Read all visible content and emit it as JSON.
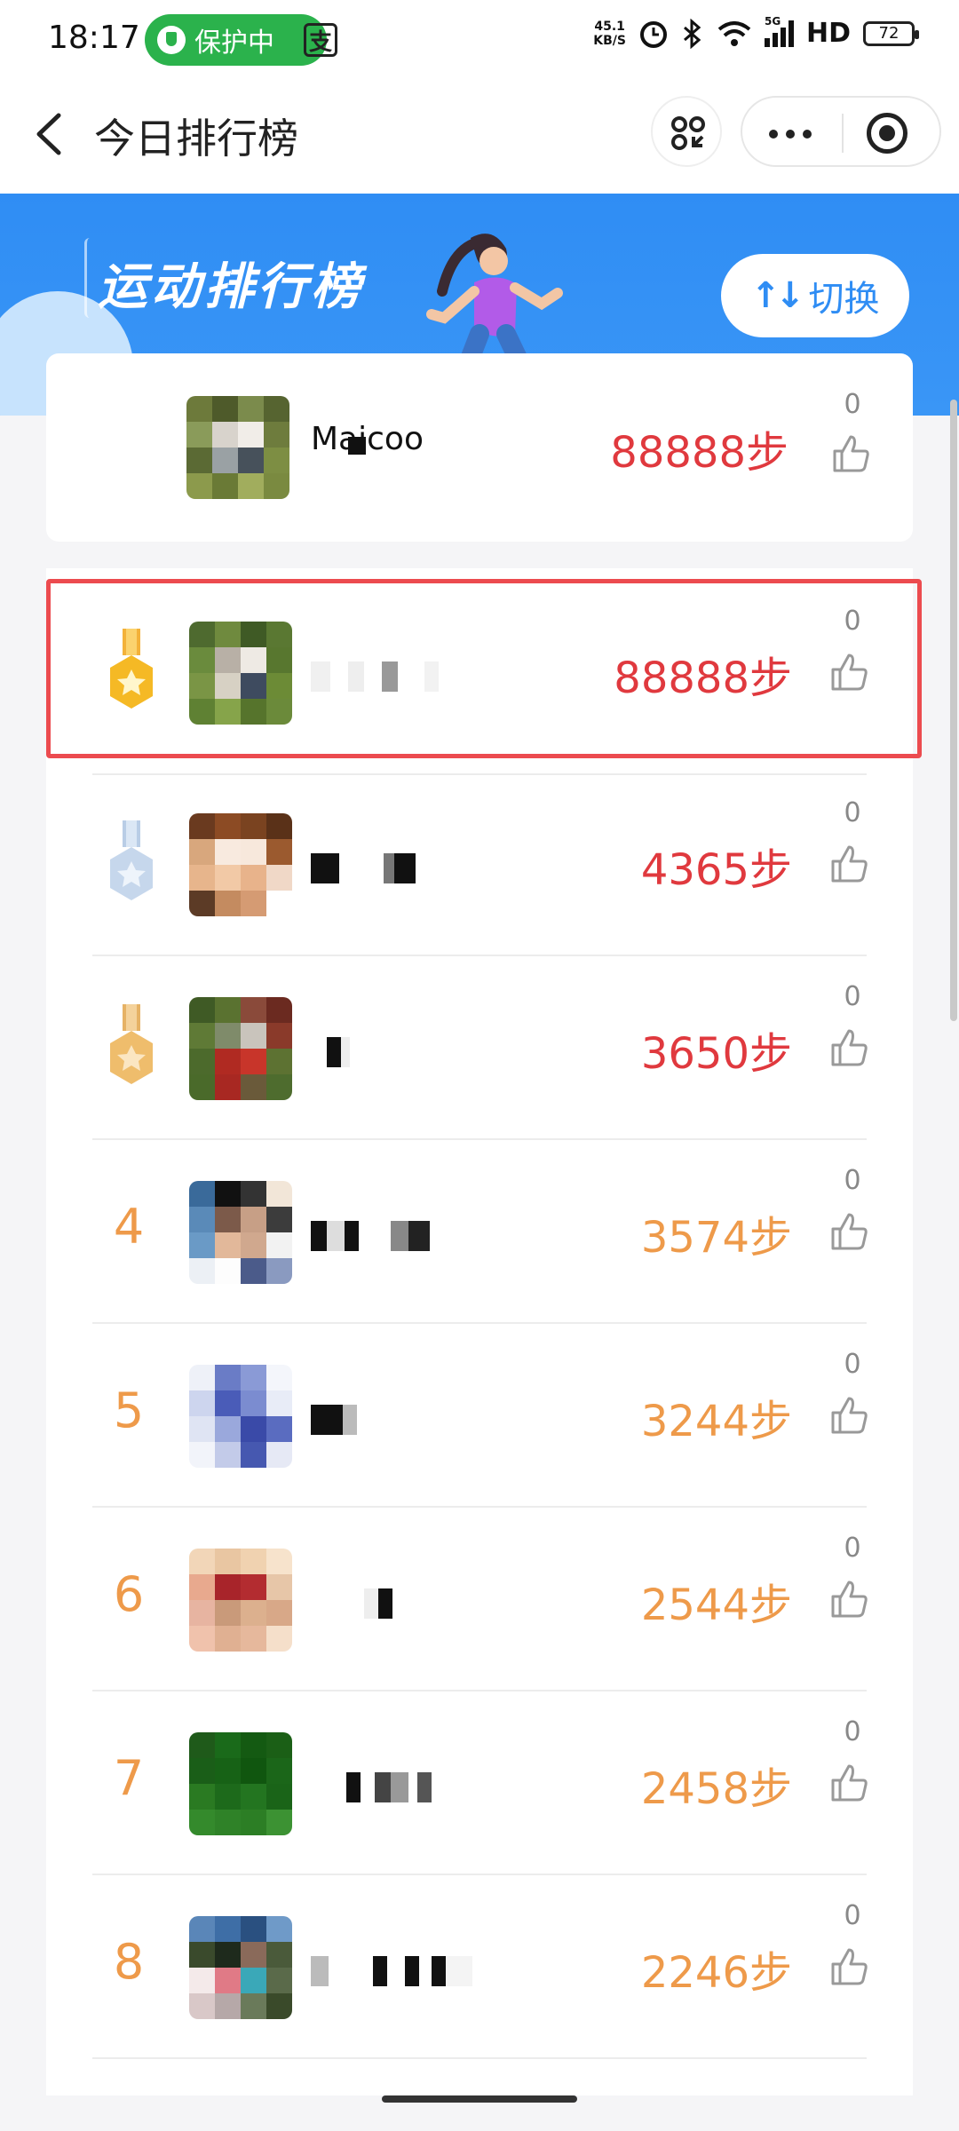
{
  "status_bar": {
    "time": "18:17",
    "protect_label": "保护中",
    "net_speed_top": "45.1",
    "net_speed_bottom": "KB/S",
    "network": "5G",
    "hd": "HD",
    "battery": "72"
  },
  "nav": {
    "title": "今日排行榜"
  },
  "banner": {
    "title": "运动排行榜",
    "switch_arrows": "↑↓",
    "switch_label": "切换"
  },
  "colors": {
    "accent_blue": "#2f8df4",
    "steps_red": "#e0393e",
    "steps_orange": "#ee9a4a",
    "highlight_red": "#ec4b4f"
  },
  "my_entry": {
    "name": "Maicoo",
    "steps": "88888步",
    "likes": "0"
  },
  "ranking": [
    {
      "rank": "",
      "medal": "gold",
      "steps": "88888步",
      "likes": "0",
      "steps_color": "red"
    },
    {
      "rank": "",
      "medal": "silver",
      "steps": "4365步",
      "likes": "0",
      "steps_color": "red"
    },
    {
      "rank": "",
      "medal": "bronze",
      "steps": "3650步",
      "likes": "0",
      "steps_color": "red"
    },
    {
      "rank": "4",
      "medal": "",
      "steps": "3574步",
      "likes": "0",
      "steps_color": "orange"
    },
    {
      "rank": "5",
      "medal": "",
      "steps": "3244步",
      "likes": "0",
      "steps_color": "orange"
    },
    {
      "rank": "6",
      "medal": "",
      "steps": "2544步",
      "likes": "0",
      "steps_color": "orange"
    },
    {
      "rank": "7",
      "medal": "",
      "steps": "2458步",
      "likes": "0",
      "steps_color": "orange"
    },
    {
      "rank": "8",
      "medal": "",
      "steps": "2246步",
      "likes": "0",
      "steps_color": "orange"
    }
  ]
}
